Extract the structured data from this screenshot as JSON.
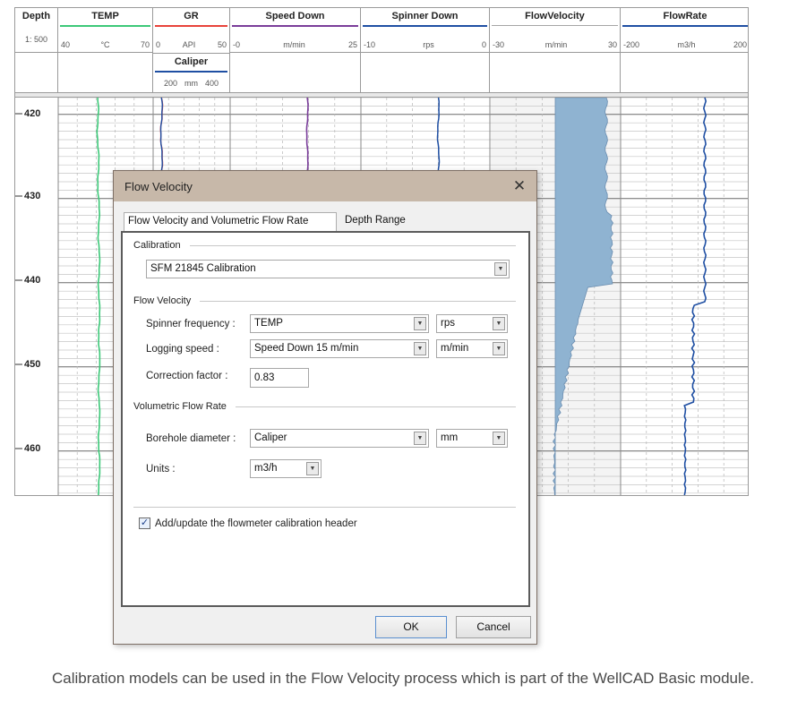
{
  "log_header": {
    "tracks": [
      {
        "id": "depth",
        "title": "Depth",
        "scale": [
          "1: 500"
        ],
        "color": "#000000"
      },
      {
        "id": "temp",
        "title": "TEMP",
        "scale": [
          "40",
          "°C",
          "70"
        ],
        "color": "#3cc878"
      },
      {
        "id": "gr",
        "title": "GR",
        "scale": [
          "0",
          "API",
          "50"
        ],
        "color": "#e8433a"
      },
      {
        "id": "speed",
        "title": "Speed Down",
        "scale": [
          "-0",
          "m/min",
          "25"
        ],
        "color": "#7a3d9a"
      },
      {
        "id": "spinner",
        "title": "Spinner Down",
        "scale": [
          "-10",
          "rps",
          "0"
        ],
        "color": "#1f4fa3"
      },
      {
        "id": "flowvel",
        "title": "FlowVelocity",
        "scale": [
          "-30",
          "m/min",
          "30"
        ],
        "color": "#7aa6c9"
      },
      {
        "id": "flowrate",
        "title": "FlowRate",
        "scale": [
          "-200",
          "m3/h",
          "200"
        ],
        "color": "#1f4fa3"
      }
    ],
    "caliper": {
      "title": "Caliper",
      "scale": [
        "200",
        "mm",
        "400"
      ],
      "color": "#1f4fa3"
    },
    "depth_ticks": [
      "420",
      "430",
      "440",
      "450",
      "460"
    ]
  },
  "dialog": {
    "title": "Flow Velocity",
    "close_symbol": "✕",
    "tabs": [
      {
        "label": "Flow Velocity and Volumetric Flow Rate",
        "active": true
      },
      {
        "label": "Depth Range",
        "active": false
      }
    ],
    "calibration": {
      "group_label": "Calibration",
      "value": "SFM 21845 Calibration"
    },
    "flow_velocity": {
      "group_label": "Flow Velocity",
      "spinner_label": "Spinner frequency :",
      "spinner_value": "TEMP",
      "spinner_unit": "rps",
      "speed_label": "Logging speed  :",
      "speed_value": "Speed Down 15 m/min",
      "speed_unit": "m/min",
      "correction_label": "Correction factor :",
      "correction_value": "0.83"
    },
    "volumetric": {
      "group_label": "Volumetric Flow Rate",
      "diameter_label": "Borehole diameter :",
      "diameter_value": "Caliper",
      "diameter_unit": "mm",
      "units_label": "Units :",
      "units_value": "m3/h"
    },
    "checkbox": {
      "label": "Add/update the flowmeter calibration header",
      "checked": true,
      "check_symbol": "✓"
    },
    "dropdown_symbol": "▼",
    "ok_label": "OK",
    "cancel_label": "Cancel"
  },
  "caption": "Calibration models can be used in the Flow Velocity process which is part of the WellCAD Basic module."
}
